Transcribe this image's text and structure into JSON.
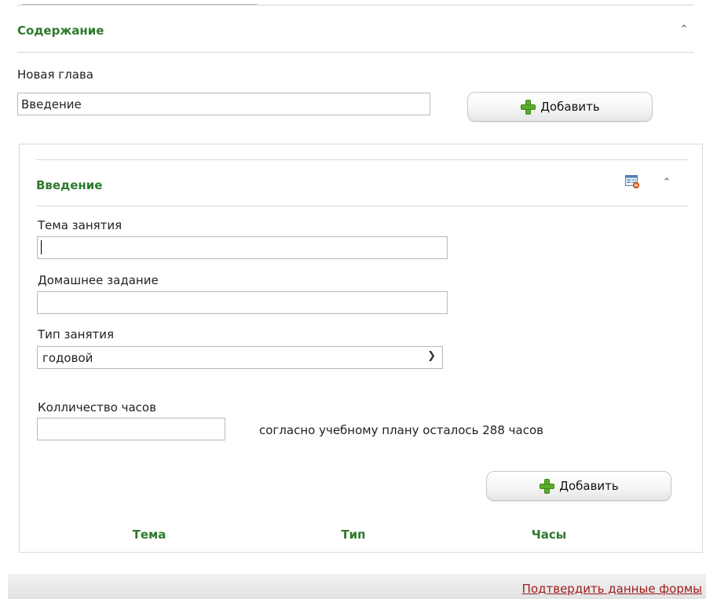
{
  "content_section": {
    "title": "Содержание",
    "collapse_glyph": "^"
  },
  "new_chapter": {
    "label": "Новая глава",
    "value": "Введение",
    "add_label": "Добавить"
  },
  "chapter": {
    "title": "Введение",
    "collapse_glyph": "^",
    "icons": [
      "properties-icon",
      "caret-up-icon"
    ],
    "topic": {
      "label": "Тема занятия",
      "value": ""
    },
    "homework": {
      "label": "Домашнее задание",
      "value": ""
    },
    "lesson_type": {
      "label": "Тип занятия",
      "selected": "годовой"
    },
    "hours": {
      "label": "Колличество часов",
      "value": "",
      "hint": "согласно учебному плану осталось 288 часов"
    },
    "add_label": "Добавить",
    "table_headers": [
      "Тема",
      "Тип",
      "Часы"
    ]
  },
  "footer": {
    "confirm_link": "Подтвердить данные формы"
  },
  "colors": {
    "section_title": "#2d7a2d",
    "link": "#a01e1e",
    "plus_icon": "#5aac2b"
  }
}
